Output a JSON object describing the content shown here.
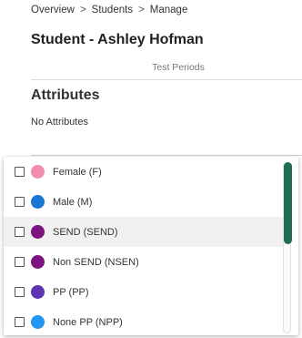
{
  "breadcrumb": {
    "items": [
      "Overview",
      "Students",
      "Manage"
    ],
    "separator": ">"
  },
  "page": {
    "title": "Student - Ashley Hofman"
  },
  "tabs": [
    {
      "label": "Test Periods"
    }
  ],
  "attributes": {
    "heading": "Attributes",
    "empty_text": "No Attributes"
  },
  "dropdown": {
    "options": [
      {
        "label": "Female (F)",
        "color": "#f28db2",
        "checked": false
      },
      {
        "label": "Male (M)",
        "color": "#1976d2",
        "checked": false
      },
      {
        "label": "SEND (SEND)",
        "color": "#7b1480",
        "checked": false
      },
      {
        "label": "Non SEND (NSEN)",
        "color": "#7b1480",
        "checked": false
      },
      {
        "label": "PP (PP)",
        "color": "#5e35b1",
        "checked": false
      },
      {
        "label": "None PP (NPP)",
        "color": "#2196f3",
        "checked": false
      }
    ],
    "highlighted": "SEND (SEND)",
    "scrollbar_color": "#1e6e56"
  }
}
